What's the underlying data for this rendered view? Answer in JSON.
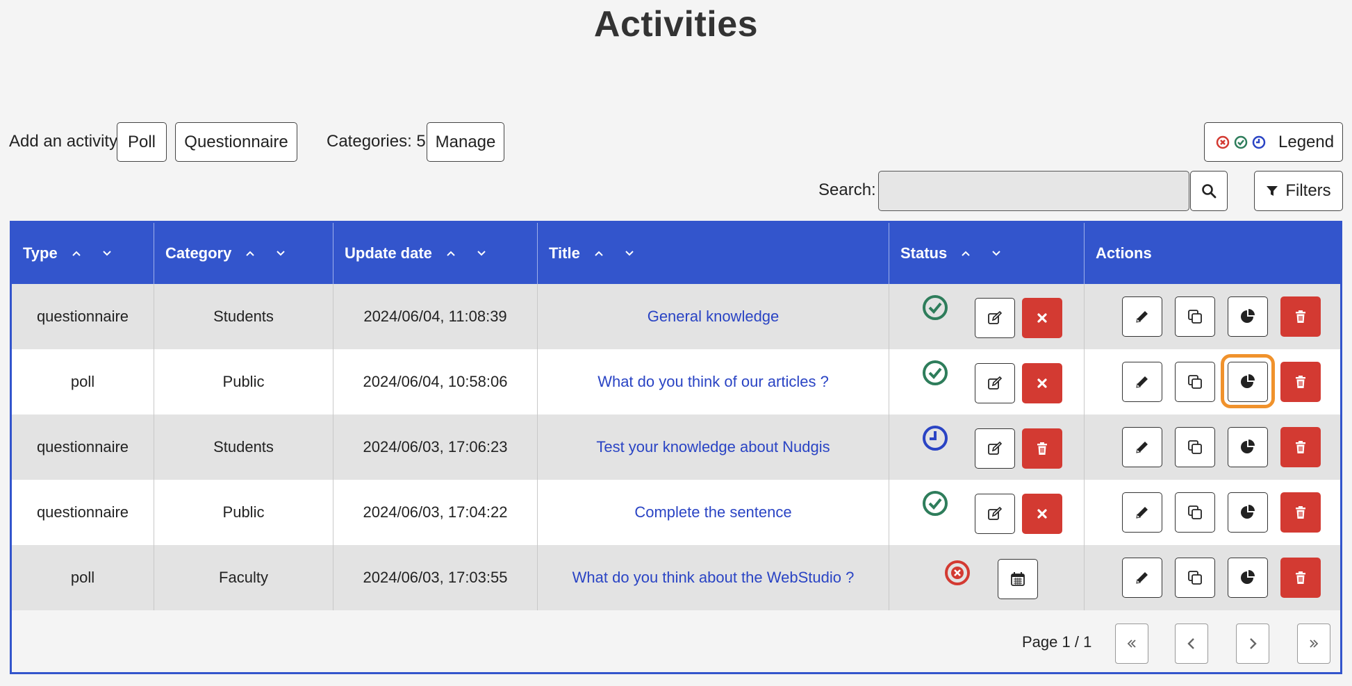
{
  "page": {
    "title": "Activities"
  },
  "toolbar": {
    "add_label": "Add an activity:",
    "poll_button": "Poll",
    "questionnaire_button": "Questionnaire",
    "categories_label": "Categories: 5",
    "manage_button": "Manage",
    "legend_button": "Legend",
    "search_label": "Search:",
    "search_value": "",
    "filters_button": "Filters"
  },
  "table": {
    "columns": [
      "Type",
      "Category",
      "Update date",
      "Title",
      "Status",
      "Actions"
    ],
    "rows": [
      {
        "type": "questionnaire",
        "category": "Students",
        "update_date": "2024/06/04, 11:08:39",
        "title": "General knowledge",
        "status": "published"
      },
      {
        "type": "poll",
        "category": "Public",
        "update_date": "2024/06/04, 10:58:06",
        "title": "What do you think of our articles ?",
        "status": "published"
      },
      {
        "type": "questionnaire",
        "category": "Students",
        "update_date": "2024/06/03, 17:06:23",
        "title": "Test your knowledge about Nudgis",
        "status": "scheduled"
      },
      {
        "type": "questionnaire",
        "category": "Public",
        "update_date": "2024/06/03, 17:04:22",
        "title": "Complete the sentence",
        "status": "published"
      },
      {
        "type": "poll",
        "category": "Faculty",
        "update_date": "2024/06/03, 17:03:55",
        "title": "What do you think about the WebStudio ?",
        "status": "unpublished"
      }
    ]
  },
  "pagination": {
    "label": "Page 1 / 1"
  },
  "colors": {
    "accent": "#3355cc",
    "published": "#2e7d5b",
    "scheduled": "#2a44c4",
    "unpublished": "#d33a32",
    "highlight": "#f0922c"
  },
  "icons": [
    "check-circle-icon",
    "clock-icon",
    "x-circle-icon",
    "edit-icon",
    "close-icon",
    "trash-icon",
    "pencil-icon",
    "copy-icon",
    "pie-chart-icon",
    "calendar-icon",
    "search-icon",
    "filter-icon"
  ]
}
